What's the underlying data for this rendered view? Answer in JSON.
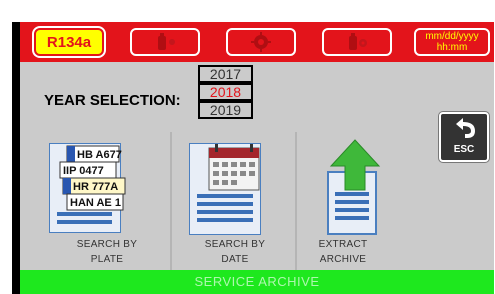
{
  "topbar": {
    "refrigerant": "R134a",
    "datetime_line1": "mm/dd/yyyy",
    "datetime_line2": "hh:mm"
  },
  "year_selection": {
    "label": "YEAR SELECTION:",
    "years": [
      "2017",
      "2018",
      "2019"
    ],
    "selected": "2018"
  },
  "actions": {
    "search_plate_line1": "SEARCH BY",
    "search_plate_line2": "PLATE",
    "search_date_line1": "SEARCH BY",
    "search_date_line2": "DATE",
    "extract_line1": "EXTRACT",
    "extract_line2": "ARCHIVE"
  },
  "plate_icon_text": [
    "HB A677",
    "IIP 0477",
    "HR 777A",
    "HAN AE 1"
  ],
  "esc_label": "ESC",
  "footer_title": "SERVICE ARCHIVE",
  "colors": {
    "topbar": "#e3141b",
    "refrigerant_bg": "#ffff00",
    "footer": "#1ee81e",
    "selected_year": "#e3141b"
  }
}
